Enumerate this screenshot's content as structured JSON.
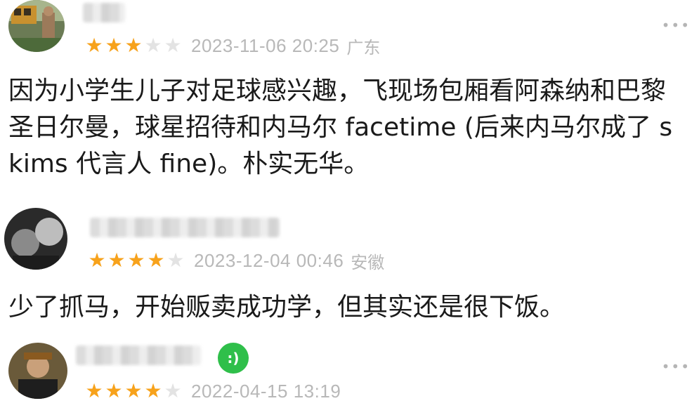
{
  "reviews": [
    {
      "rating": 3,
      "max_rating": 5,
      "date": "2023-11-06 20:25",
      "region": "广东",
      "more_label": "•••",
      "comment": "因为小学生儿子对足球感兴趣，飞现场包厢看阿森纳和巴黎圣日尔曼，球星招待和内马尔 facetime (后来内马尔成了 skims 代言人 fine)。朴实无华。"
    },
    {
      "rating": 4,
      "max_rating": 5,
      "date": "2023-12-04 00:46",
      "region": "安徽",
      "comment": "少了抓马，开始贩卖成功学，但其实还是很下饭。"
    },
    {
      "rating": 4,
      "max_rating": 5,
      "date": "2022-04-15 13:19",
      "more_label": "•••",
      "badge_icon": "green-smile-badge-icon"
    }
  ],
  "colors": {
    "star_on": "#f7a21b",
    "star_off": "#e3e3e3",
    "meta_text": "#b8b8b8",
    "badge": "#2fbf4a"
  }
}
